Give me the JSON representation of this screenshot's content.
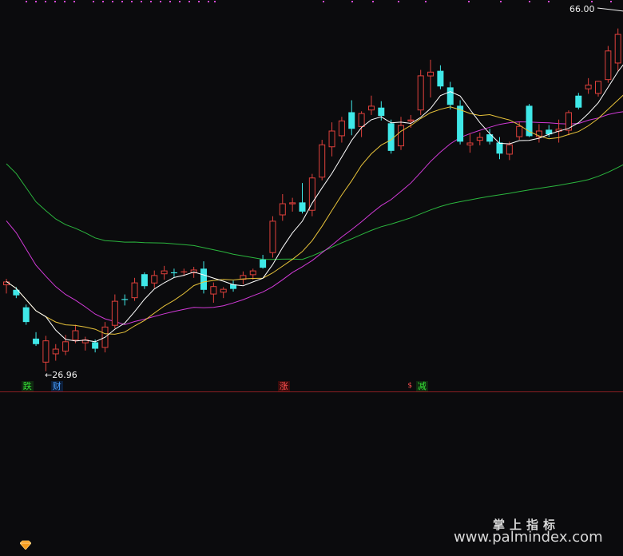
{
  "chart_data": {
    "type": "candlestick",
    "high_label": "66.00",
    "low_label": "26.96",
    "ylim": [
      25.8,
      66.6
    ],
    "colors": {
      "up": "#e0413c",
      "down": "#3fe8e8",
      "ma5": "#ffffff",
      "ma10": "#e8c33a",
      "ma20": "#d23ad8",
      "ma60": "#2bb63e",
      "divider": "#8a1e22",
      "top_markers": "#d64ad6"
    },
    "candles": [
      [
        36.3,
        37.0,
        35.4,
        36.7
      ],
      [
        35.8,
        36.1,
        34.9,
        35.2
      ],
      [
        33.9,
        34.2,
        32.0,
        32.3
      ],
      [
        30.5,
        31.2,
        29.7,
        29.9
      ],
      [
        27.9,
        30.8,
        26.96,
        30.3
      ],
      [
        28.8,
        29.9,
        28.1,
        29.4
      ],
      [
        29.1,
        30.9,
        28.7,
        30.2
      ],
      [
        30.3,
        32.0,
        30.0,
        31.4
      ],
      [
        30.0,
        30.7,
        29.2,
        30.4
      ],
      [
        30.1,
        30.4,
        29.0,
        29.4
      ],
      [
        29.5,
        32.3,
        29.0,
        31.8
      ],
      [
        31.9,
        35.3,
        31.6,
        34.6
      ],
      [
        34.8,
        35.3,
        34.1,
        34.7
      ],
      [
        34.9,
        37.1,
        34.6,
        36.6
      ],
      [
        37.5,
        37.7,
        35.9,
        36.2
      ],
      [
        36.5,
        37.9,
        36.0,
        37.4
      ],
      [
        37.5,
        38.4,
        36.9,
        37.9
      ],
      [
        37.7,
        38.1,
        37.2,
        37.6
      ],
      [
        37.7,
        38.1,
        37.3,
        37.8
      ],
      [
        37.6,
        38.3,
        37.1,
        38.0
      ],
      [
        38.1,
        38.9,
        35.4,
        35.8
      ],
      [
        35.3,
        36.6,
        34.4,
        36.2
      ],
      [
        35.5,
        36.1,
        34.9,
        35.9
      ],
      [
        36.4,
        36.8,
        35.6,
        35.9
      ],
      [
        36.9,
        37.8,
        36.4,
        37.4
      ],
      [
        37.4,
        38.1,
        36.9,
        37.9
      ],
      [
        39.1,
        39.6,
        38.1,
        38.2
      ],
      [
        39.8,
        43.8,
        39.3,
        43.3
      ],
      [
        43.9,
        46.2,
        43.3,
        45.2
      ],
      [
        45.1,
        45.8,
        44.3,
        45.3
      ],
      [
        45.3,
        47.4,
        44.1,
        44.3
      ],
      [
        44.4,
        48.4,
        43.8,
        48.0
      ],
      [
        48.0,
        52.1,
        47.7,
        51.6
      ],
      [
        51.3,
        54.0,
        50.3,
        53.1
      ],
      [
        52.5,
        54.6,
        51.8,
        54.2
      ],
      [
        55.1,
        56.4,
        52.6,
        53.3
      ],
      [
        53.5,
        55.2,
        52.4,
        55.0
      ],
      [
        55.3,
        56.9,
        54.8,
        55.8
      ],
      [
        55.6,
        56.3,
        54.2,
        54.7
      ],
      [
        53.9,
        54.3,
        50.6,
        50.9
      ],
      [
        51.4,
        54.6,
        51.0,
        53.7
      ],
      [
        54.1,
        54.8,
        53.4,
        54.3
      ],
      [
        55.3,
        59.7,
        54.8,
        59.1
      ],
      [
        59.0,
        60.8,
        56.7,
        59.5
      ],
      [
        59.6,
        60.2,
        57.6,
        57.9
      ],
      [
        57.8,
        58.4,
        55.4,
        55.9
      ],
      [
        55.8,
        56.4,
        51.6,
        51.9
      ],
      [
        51.5,
        52.8,
        50.7,
        51.8
      ],
      [
        52.0,
        52.9,
        51.5,
        52.4
      ],
      [
        52.7,
        53.3,
        51.6,
        51.9
      ],
      [
        51.8,
        52.4,
        50.0,
        50.6
      ],
      [
        50.5,
        51.9,
        49.9,
        51.6
      ],
      [
        52.4,
        54.0,
        52.1,
        53.6
      ],
      [
        55.8,
        56.0,
        52.4,
        52.5
      ],
      [
        52.4,
        53.8,
        51.8,
        53.1
      ],
      [
        53.2,
        53.7,
        52.4,
        52.7
      ],
      [
        53.0,
        54.3,
        51.8,
        53.3
      ],
      [
        53.1,
        55.3,
        52.6,
        55.1
      ],
      [
        56.9,
        57.2,
        55.4,
        55.6
      ],
      [
        57.6,
        58.8,
        57.1,
        58.1
      ],
      [
        57.1,
        58.5,
        56.8,
        58.5
      ],
      [
        58.6,
        62.3,
        58.3,
        61.8
      ],
      [
        60.4,
        64.2,
        59.6,
        63.6
      ],
      [
        62.1,
        63.3,
        60.2,
        62.5
      ],
      [
        60.6,
        66.0,
        60.2,
        65.4
      ]
    ],
    "annotations": [
      {
        "text": "跌",
        "candle": 2,
        "style": "green"
      },
      {
        "text": "财",
        "candle": 5,
        "style": "blue"
      },
      {
        "text": "涨",
        "candle": 28,
        "style": "red"
      },
      {
        "text": "减",
        "candle": 42,
        "style": "green"
      },
      {
        "text": "$",
        "candle": 41,
        "style": "red-small"
      }
    ]
  },
  "watermark": {
    "cn": "掌上指标",
    "url": "www.palmindex.com"
  }
}
